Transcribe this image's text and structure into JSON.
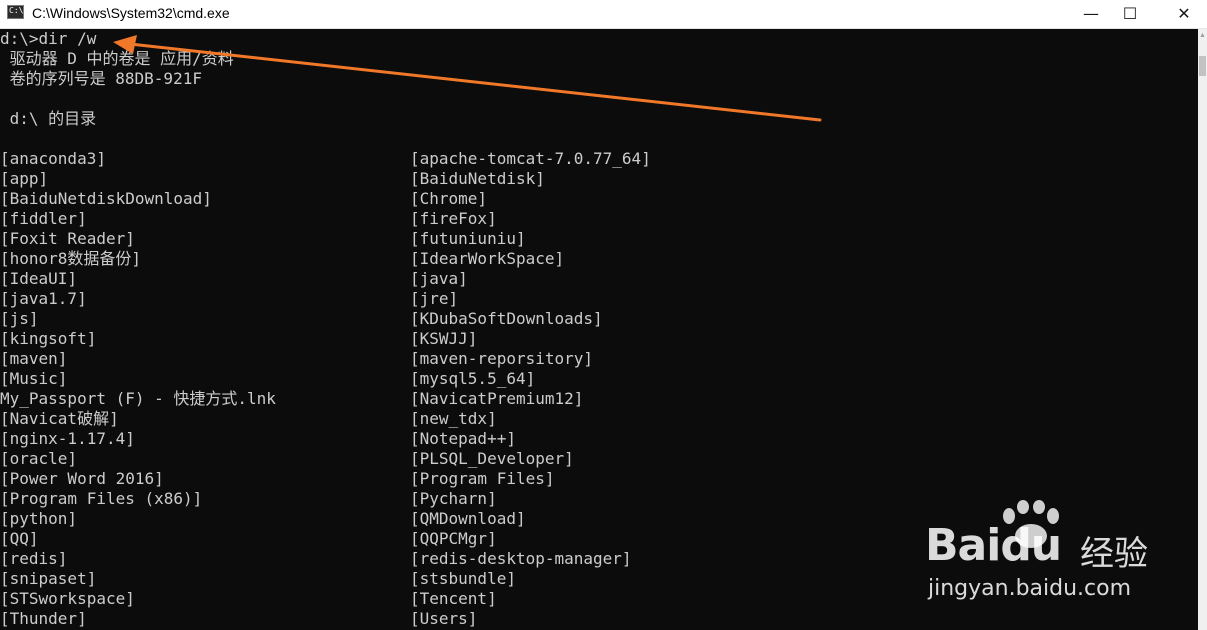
{
  "window": {
    "title": "C:\\Windows\\System32\\cmd.exe",
    "icon_text": "C:\\",
    "controls": {
      "minimize": "—",
      "maximize": "☐",
      "close": "✕"
    }
  },
  "console": {
    "command": "d:\\>dir /w",
    "volume_line": " 驱动器 D 中的卷是 应用/资料",
    "serial_line": " 卷的序列号是 88DB-921F",
    "directory_line": " d:\\ 的目录",
    "left_column": [
      "[anaconda3]",
      "[app]",
      "[BaiduNetdiskDownload]",
      "[fiddler]",
      "[Foxit Reader]",
      "[honor8数据备份]",
      "[IdeaUI]",
      "[java1.7]",
      "[js]",
      "[kingsoft]",
      "[maven]",
      "[Music]",
      "My_Passport (F) - 快捷方式.lnk",
      "[Navicat破解]",
      "[nginx-1.17.4]",
      "[oracle]",
      "[Power Word 2016]",
      "[Program Files (x86)]",
      "[python]",
      "[QQ]",
      "[redis]",
      "[snipaset]",
      "[STSworkspace]",
      "[Thunder]"
    ],
    "right_column": [
      "[apache-tomcat-7.0.77_64]",
      "[BaiduNetdisk]",
      "[Chrome]",
      "[fireFox]",
      "[futuniuniu]",
      "[IdearWorkSpace]",
      "[java]",
      "[jre]",
      "[KDubaSoftDownloads]",
      "[KSWJJ]",
      "[maven-reporsitory]",
      "[mysql5.5_64]",
      "[NavicatPremium12]",
      "[new_tdx]",
      "[Notepad++]",
      "[PLSQL_Developer]",
      "[Program Files]",
      "[Pycharn]",
      "[QMDownload]",
      "[QQPCMgr]",
      "[redis-desktop-manager]",
      "[stsbundle]",
      "[Tencent]",
      "[Users]"
    ]
  },
  "watermark": {
    "brand_a": "Bai",
    "brand_b": "du",
    "product": "经验",
    "url": "jingyan.baidu.com"
  },
  "colors": {
    "console_bg": "#0c0c0c",
    "console_text": "#cccccc",
    "arrow": "#f07828"
  }
}
